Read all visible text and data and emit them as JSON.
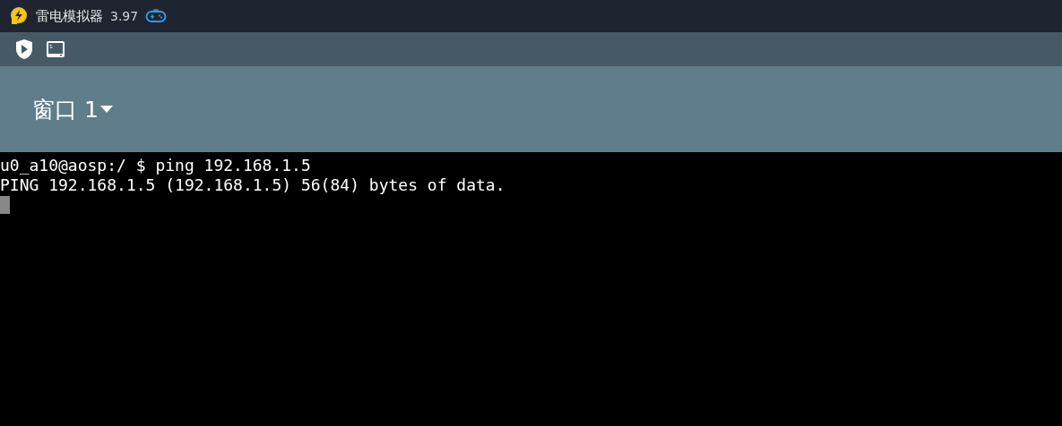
{
  "window": {
    "title": "雷电模拟器",
    "version": "3.97"
  },
  "app_bar": {
    "title": "窗口 1"
  },
  "terminal": {
    "lines": [
      "u0_a10@aosp:/ $ ping 192.168.1.5",
      "PING 192.168.1.5 (192.168.1.5) 56(84) bytes of data."
    ]
  }
}
